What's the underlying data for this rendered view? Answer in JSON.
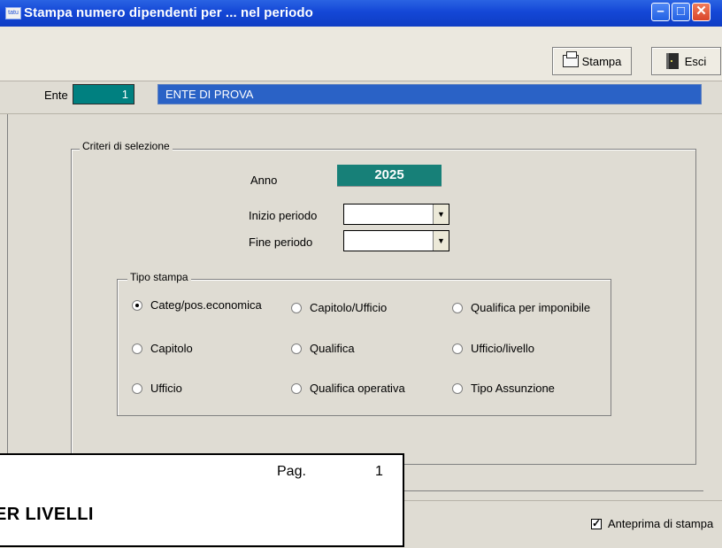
{
  "window": {
    "app_icon_text": "tatu",
    "title": "Stampa numero dipendenti per ...  nel periodo",
    "minimize_label": "–",
    "maximize_label": "□",
    "close_label": "✕"
  },
  "toolbar": {
    "stampa_label": "Stampa",
    "esci_label": "Esci"
  },
  "ente": {
    "label": "Ente",
    "code": "1",
    "name": "ENTE DI PROVA"
  },
  "criteria": {
    "legend": "Criteri di selezione",
    "anno_label": "Anno",
    "anno_value": "2025",
    "inizio_label": "Inizio periodo",
    "inizio_value": "",
    "fine_label": "Fine periodo",
    "fine_value": ""
  },
  "tipo_stampa": {
    "legend": "Tipo stampa",
    "options": [
      {
        "label": "Categ/pos.economica",
        "checked": true
      },
      {
        "label": "Capitolo/Ufficio",
        "checked": false
      },
      {
        "label": "Qualifica per imponibile",
        "checked": false
      },
      {
        "label": "Capitolo",
        "checked": false
      },
      {
        "label": "Qualifica",
        "checked": false
      },
      {
        "label": "Ufficio/livello",
        "checked": false
      },
      {
        "label": "Ufficio",
        "checked": false
      },
      {
        "label": "Qualifica operativa",
        "checked": false
      },
      {
        "label": "Tipo Assunzione",
        "checked": false
      }
    ]
  },
  "preview": {
    "label": "Anteprima di stampa",
    "checked": true
  },
  "report": {
    "pag_label": "Pag.",
    "pag_number": "1",
    "heading": "ER LIVELLI"
  }
}
